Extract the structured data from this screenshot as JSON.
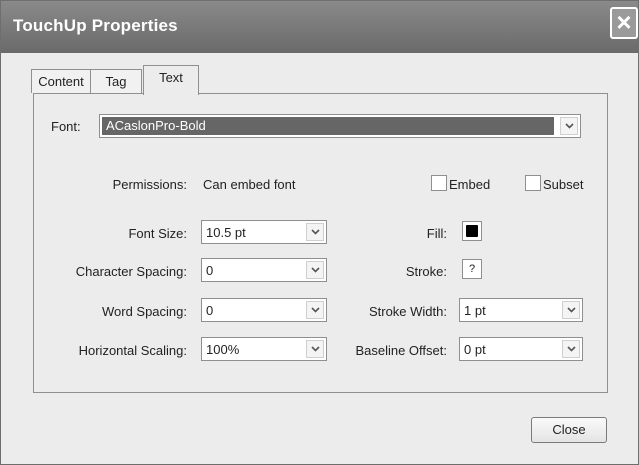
{
  "window": {
    "title": "TouchUp Properties"
  },
  "tabs": [
    {
      "label": "Content"
    },
    {
      "label": "Tag"
    },
    {
      "label": "Text"
    }
  ],
  "font": {
    "label": "Font:",
    "value": "ACaslonPro-Bold"
  },
  "permissions": {
    "label": "Permissions:",
    "value": "Can embed font"
  },
  "embed": {
    "label": "Embed"
  },
  "subset": {
    "label": "Subset"
  },
  "font_size": {
    "label": "Font Size:",
    "value": "10.5 pt"
  },
  "character_spacing": {
    "label": "Character Spacing:",
    "value": "0"
  },
  "word_spacing": {
    "label": "Word Spacing:",
    "value": "0"
  },
  "horizontal_scaling": {
    "label": "Horizontal Scaling:",
    "value": "100%"
  },
  "fill": {
    "label": "Fill:",
    "color": "#000000"
  },
  "stroke": {
    "label": "Stroke:",
    "value": "?"
  },
  "stroke_width": {
    "label": "Stroke Width:",
    "value": "1 pt"
  },
  "baseline_offset": {
    "label": "Baseline Offset:",
    "value": "0 pt"
  },
  "close_button": {
    "label": "Close"
  }
}
